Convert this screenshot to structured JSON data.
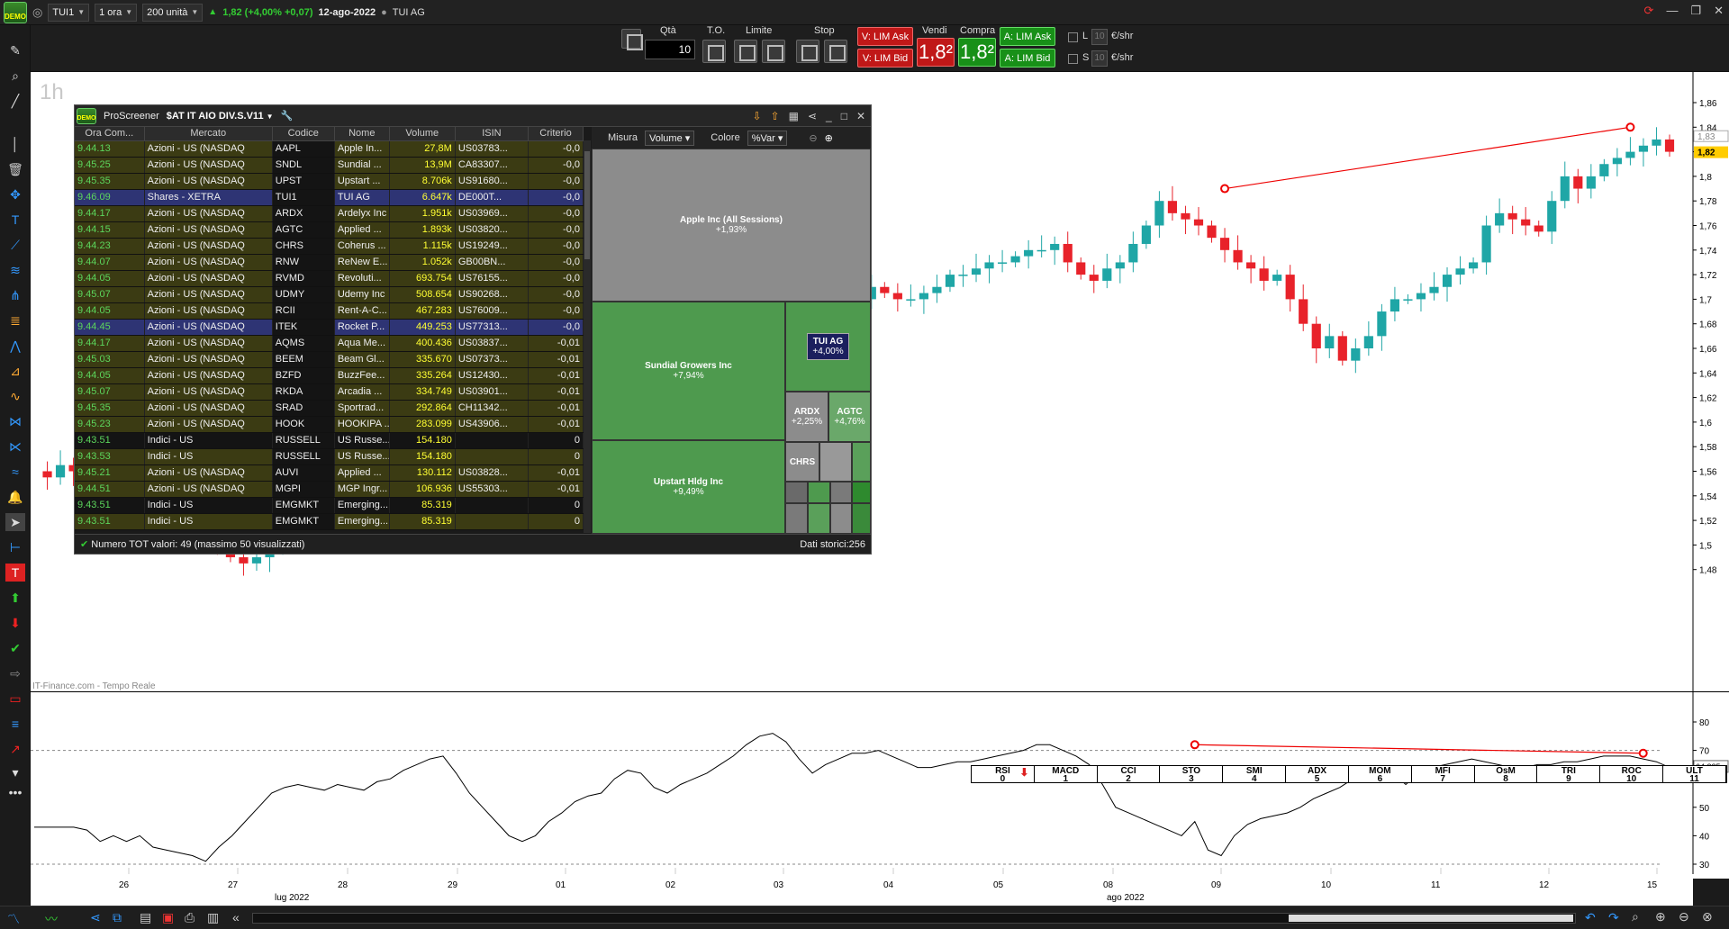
{
  "topbar": {
    "symbol": "TUI1",
    "timeframe": "1 ora",
    "units": "200 unità",
    "price_change": "1,82 (+4,00% +0,07)",
    "date": "12-ago-2022",
    "instrument_name": "TUI AG",
    "logo_text": "DEMO"
  },
  "orderbar": {
    "qty_label": "Qtà",
    "qty_value": "10",
    "to_label": "T.O.",
    "limit_label": "Limite",
    "stop_label": "Stop",
    "sell_label": "Vendi",
    "buy_label": "Compra",
    "v_lim_ask": "V: LIM Ask",
    "v_lim_bid": "V: LIM Bid",
    "a_lim_ask": "A: LIM Ask",
    "a_lim_bid": "A: LIM Bid",
    "sell_price": "1,8²",
    "buy_price": "1,8²",
    "l_label": "L",
    "s_label": "S",
    "l_value": "10",
    "s_value": "10",
    "unit": "€/shr"
  },
  "chart": {
    "timeframe_label": "1h",
    "source_label": "IT-Finance.com - Tempo Reale",
    "price_axis": [
      "1,86",
      "1,84",
      "1,82",
      "1,8",
      "1,78",
      "1,76",
      "1,74",
      "1,72",
      "1,7",
      "1,68",
      "1,66",
      "1,64",
      "1,62",
      "1,6",
      "1,58",
      "1,56",
      "1,54",
      "1,52",
      "1,5",
      "1,48"
    ],
    "last_price": "1,82",
    "prev_price": "1,83",
    "rsi_axis": [
      "80",
      "70",
      "60",
      "50",
      "40",
      "30"
    ],
    "rsi_value": "64,225",
    "x_labels": [
      "26",
      "27",
      "28",
      "29",
      "01",
      "02",
      "03",
      "04",
      "05",
      "08",
      "09",
      "10",
      "11",
      "12",
      "15"
    ],
    "month_labels": [
      "lug 2022",
      "ago 2022"
    ],
    "up_color": "#1fa6a6",
    "down_color": "#e8222a"
  },
  "indicator_tabs": [
    {
      "name": "RSI",
      "num": "0"
    },
    {
      "name": "MACD",
      "num": "1"
    },
    {
      "name": "CCI",
      "num": "2"
    },
    {
      "name": "STO",
      "num": "3"
    },
    {
      "name": "SMI",
      "num": "4"
    },
    {
      "name": "ADX",
      "num": "5"
    },
    {
      "name": "MOM",
      "num": "6"
    },
    {
      "name": "MFI",
      "num": "7"
    },
    {
      "name": "OsM",
      "num": "8"
    },
    {
      "name": "TRI",
      "num": "9"
    },
    {
      "name": "ROC",
      "num": "10"
    },
    {
      "name": "ULT",
      "num": "11"
    }
  ],
  "screener": {
    "app_name": "ProScreener",
    "list_name": "$AT IT AIO DIV.S.V11",
    "columns": [
      "Ora Com...",
      "Mercato",
      "Codice",
      "Nome",
      "Volume",
      "ISIN",
      "Criterio"
    ],
    "rows": [
      {
        "time": "9.44.13",
        "market": "Azioni - US (NASDAQ",
        "code": "AAPL",
        "name": "Apple In...",
        "volume": "27,8M",
        "isin": "US03783...",
        "crit": "-0,0",
        "style": "olive"
      },
      {
        "time": "9.45.25",
        "market": "Azioni - US (NASDAQ",
        "code": "SNDL",
        "name": "Sundial ...",
        "volume": "13,9M",
        "isin": "CA83307...",
        "crit": "-0,0",
        "style": "olive"
      },
      {
        "time": "9.45.35",
        "market": "Azioni - US (NASDAQ",
        "code": "UPST",
        "name": "Upstart ...",
        "volume": "8.706k",
        "isin": "US91680...",
        "crit": "-0,0",
        "style": "olive"
      },
      {
        "time": "9.46.09",
        "market": "Shares - XETRA",
        "code": "TUI1",
        "name": "TUI AG",
        "volume": "6.647k",
        "isin": "DE000T...",
        "crit": "-0,0",
        "style": "blue"
      },
      {
        "time": "9.44.17",
        "market": "Azioni - US (NASDAQ",
        "code": "ARDX",
        "name": "Ardelyx Inc",
        "volume": "1.951k",
        "isin": "US03969...",
        "crit": "-0,0",
        "style": "olive"
      },
      {
        "time": "9.44.15",
        "market": "Azioni - US (NASDAQ",
        "code": "AGTC",
        "name": "Applied ...",
        "volume": "1.893k",
        "isin": "US03820...",
        "crit": "-0,0",
        "style": "olive"
      },
      {
        "time": "9.44.23",
        "market": "Azioni - US (NASDAQ",
        "code": "CHRS",
        "name": "Coherus ...",
        "volume": "1.115k",
        "isin": "US19249...",
        "crit": "-0,0",
        "style": "olive"
      },
      {
        "time": "9.44.07",
        "market": "Azioni - US (NASDAQ",
        "code": "RNW",
        "name": "ReNew E...",
        "volume": "1.052k",
        "isin": "GB00BN...",
        "crit": "-0,0",
        "style": "olive"
      },
      {
        "time": "9.44.05",
        "market": "Azioni - US (NASDAQ",
        "code": "RVMD",
        "name": "Revoluti...",
        "volume": "693.754",
        "isin": "US76155...",
        "crit": "-0,0",
        "style": "olive"
      },
      {
        "time": "9.45.07",
        "market": "Azioni - US (NASDAQ",
        "code": "UDMY",
        "name": "Udemy Inc",
        "volume": "508.654",
        "isin": "US90268...",
        "crit": "-0,0",
        "style": "olive"
      },
      {
        "time": "9.44.05",
        "market": "Azioni - US (NASDAQ",
        "code": "RCII",
        "name": "Rent-A-C...",
        "volume": "467.283",
        "isin": "US76009...",
        "crit": "-0,0",
        "style": "olive"
      },
      {
        "time": "9.44.45",
        "market": "Azioni - US (NASDAQ",
        "code": "ITEK",
        "name": "Rocket P...",
        "volume": "449.253",
        "isin": "US77313...",
        "crit": "-0,0",
        "style": "blue"
      },
      {
        "time": "9.44.17",
        "market": "Azioni - US (NASDAQ",
        "code": "AQMS",
        "name": "Aqua Me...",
        "volume": "400.436",
        "isin": "US03837...",
        "crit": "-0,01",
        "style": "olive"
      },
      {
        "time": "9.45.03",
        "market": "Azioni - US (NASDAQ",
        "code": "BEEM",
        "name": "Beam Gl...",
        "volume": "335.670",
        "isin": "US07373...",
        "crit": "-0,01",
        "style": "olive"
      },
      {
        "time": "9.44.05",
        "market": "Azioni - US (NASDAQ",
        "code": "BZFD",
        "name": "BuzzFee...",
        "volume": "335.264",
        "isin": "US12430...",
        "crit": "-0,01",
        "style": "olive"
      },
      {
        "time": "9.45.07",
        "market": "Azioni - US (NASDAQ",
        "code": "RKDA",
        "name": "Arcadia ...",
        "volume": "334.749",
        "isin": "US03901...",
        "crit": "-0,01",
        "style": "olive"
      },
      {
        "time": "9.45.35",
        "market": "Azioni - US (NASDAQ",
        "code": "SRAD",
        "name": "Sportrad...",
        "volume": "292.864",
        "isin": "CH11342...",
        "crit": "-0,01",
        "style": "olive"
      },
      {
        "time": "9.45.23",
        "market": "Azioni - US (NASDAQ",
        "code": "HOOK",
        "name": "HOOKIPA ...",
        "volume": "283.099",
        "isin": "US43906...",
        "crit": "-0,01",
        "style": "olive"
      },
      {
        "time": "9.43.51",
        "market": "Indici - US",
        "code": "RUSSELL",
        "name": "US Russe...",
        "volume": "154.180",
        "isin": "",
        "crit": "0",
        "style": "dark"
      },
      {
        "time": "9.43.53",
        "market": "Indici - US",
        "code": "RUSSELL",
        "name": "US Russe...",
        "volume": "154.180",
        "isin": "",
        "crit": "0",
        "style": "olive"
      },
      {
        "time": "9.45.21",
        "market": "Azioni - US (NASDAQ",
        "code": "AUVI",
        "name": "Applied ...",
        "volume": "130.112",
        "isin": "US03828...",
        "crit": "-0,01",
        "style": "olive"
      },
      {
        "time": "9.44.51",
        "market": "Azioni - US (NASDAQ",
        "code": "MGPI",
        "name": "MGP Ingr...",
        "volume": "106.936",
        "isin": "US55303...",
        "crit": "-0,01",
        "style": "olive"
      },
      {
        "time": "9.43.51",
        "market": "Indici - US",
        "code": "EMGMKT",
        "name": "Emerging...",
        "volume": "85.319",
        "isin": "",
        "crit": "0",
        "style": "dark"
      },
      {
        "time": "9.43.51",
        "market": "Indici - US",
        "code": "EMGMKT",
        "name": "Emerging...",
        "volume": "85.319",
        "isin": "",
        "crit": "0",
        "style": "olive"
      }
    ],
    "status_left": "Numero TOT valori: 49 (massimo 50 visualizzati)",
    "status_right": "Dati storici:256",
    "treemap": {
      "measure_label": "Misura",
      "measure_value": "Volume",
      "color_label": "Colore",
      "color_value": "%Var",
      "cells": [
        {
          "name": "Apple Inc (All Sessions)",
          "pct": "+1,93%"
        },
        {
          "name": "Sundial Growers Inc",
          "pct": "+7,94%"
        },
        {
          "name": "TUI AG",
          "pct": "+4,00%"
        },
        {
          "name": "ARDX",
          "pct": "+2,25%"
        },
        {
          "name": "AGTC",
          "pct": "+4,76%"
        },
        {
          "name": "CHRS",
          "pct": ""
        },
        {
          "name": "Upstart Hldg Inc",
          "pct": "+9,49%"
        }
      ]
    }
  }
}
